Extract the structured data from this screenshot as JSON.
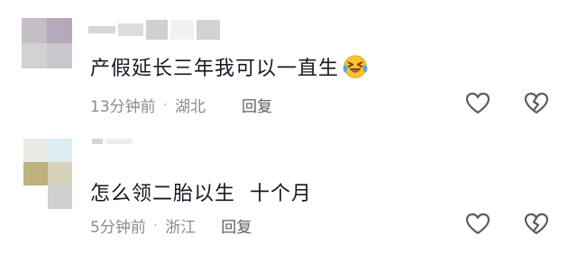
{
  "comments": [
    {
      "text": "产假延长三年我可以一直生",
      "time": "13分钟前",
      "location": "湖北",
      "reply_label": "回复",
      "emoji_icon": "laughing-tears-emoji-icon"
    },
    {
      "text": "怎么领二胎以生  十个月",
      "time": "5分钟前",
      "location": "浙江",
      "reply_label": "回复"
    }
  ],
  "icons": {
    "like": "heart-outline-icon",
    "dislike": "broken-heart-icon"
  },
  "colors": {
    "text": "#161823",
    "meta": "#8a8b91",
    "icon": "#5a5b63"
  }
}
